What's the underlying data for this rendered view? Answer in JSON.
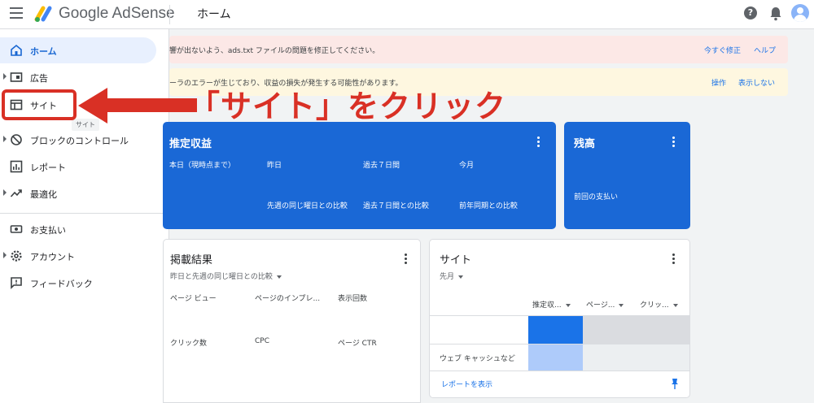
{
  "header": {
    "brand": "Google AdSense",
    "page_title": "ホーム"
  },
  "sidebar": {
    "items": [
      {
        "label": "ホーム",
        "icon": "home-icon"
      },
      {
        "label": "広告",
        "icon": "ads-icon"
      },
      {
        "label": "サイト",
        "icon": "site-icon"
      },
      {
        "label": "ブロックのコントロール",
        "icon": "block-icon"
      },
      {
        "label": "レポート",
        "icon": "report-icon"
      },
      {
        "label": "最適化",
        "icon": "optimize-icon"
      },
      {
        "label": "お支払い",
        "icon": "payments-icon"
      },
      {
        "label": "アカウント",
        "icon": "account-gear-icon"
      },
      {
        "label": "フィードバック",
        "icon": "feedback-icon"
      }
    ],
    "tooltip": "サイト"
  },
  "banners": {
    "red": {
      "text": "響が出ないよう、ads.txt ファイルの問題を修正してください。",
      "action1": "今すぐ修正",
      "action2": "ヘルプ"
    },
    "yellow": {
      "text": "ーラのエラーが生じており、収益の損失が発生する可能性があります。",
      "action1": "操作",
      "action2": "表示しない"
    }
  },
  "callout": "「サイト」をクリック",
  "earnings": {
    "title": "推定収益",
    "cols": [
      "本日（現時点まで）",
      "昨日",
      "過去７日間",
      "今月"
    ],
    "compare": [
      "先週の同じ曜日との比較",
      "過去７日間との比較",
      "前年同期との比較"
    ]
  },
  "balance": {
    "title": "残高",
    "last_payment": "前回の支払い"
  },
  "performance": {
    "title": "掲載結果",
    "period": "昨日と先週の同じ曜日との比較",
    "metrics": [
      "ページ ビュー",
      "ページのインプレ...",
      "表示回数",
      "クリック数",
      "CPC",
      "ページ CTR"
    ]
  },
  "sites": {
    "title": "サイト",
    "period": "先月",
    "columns": [
      "推定収...",
      "ページ...",
      "クリッ..."
    ],
    "row_label": "ウェブ キャッシュなど",
    "link": "レポートを表示"
  },
  "colors": {
    "accent": "#1a73e8",
    "card_blue": "#1a68d6",
    "callout_red": "#d93025"
  }
}
